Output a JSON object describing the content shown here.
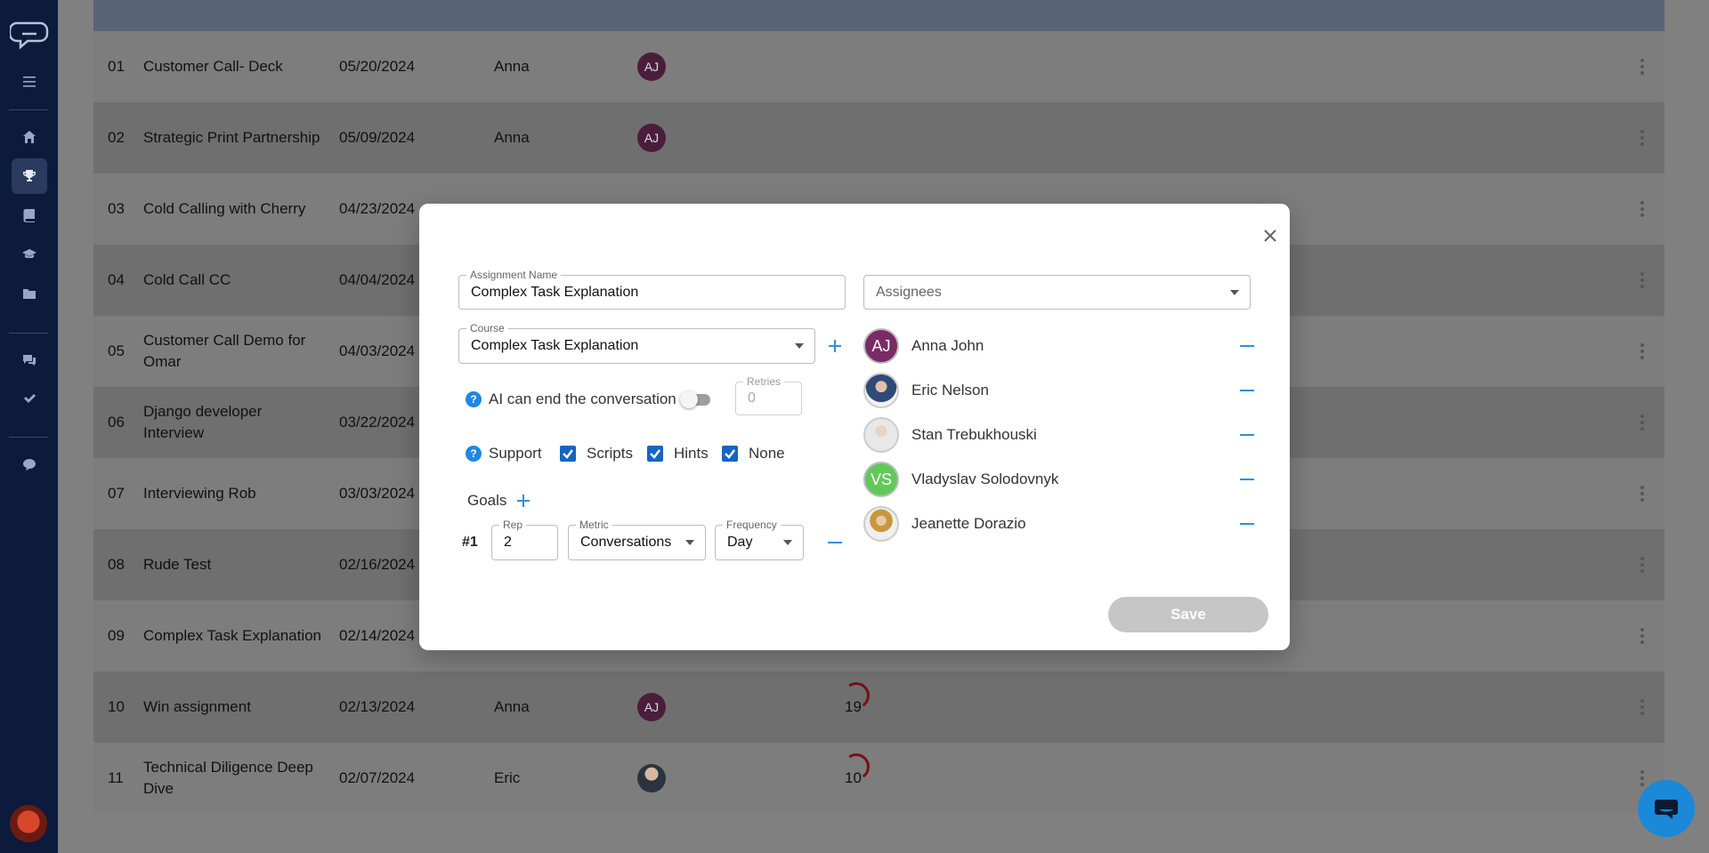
{
  "table": {
    "rows": [
      {
        "num": "01",
        "name": "Customer Call- Deck",
        "date": "05/20/2024",
        "by": "Anna",
        "avatar": "AJ",
        "progress": ""
      },
      {
        "num": "02",
        "name": "Strategic Print Partnership",
        "date": "05/09/2024",
        "by": "Anna",
        "avatar": "AJ",
        "progress": ""
      },
      {
        "num": "03",
        "name": "Cold Calling with Cherry",
        "date": "04/23/2024",
        "by": "",
        "avatar": "",
        "progress": ""
      },
      {
        "num": "04",
        "name": "Cold Call CC",
        "date": "04/04/2024",
        "by": "",
        "avatar": "",
        "progress": ""
      },
      {
        "num": "05",
        "name": "Customer Call Demo for Omar",
        "date": "04/03/2024",
        "by": "",
        "avatar": "",
        "progress": ""
      },
      {
        "num": "06",
        "name": "Django developer Interview",
        "date": "03/22/2024",
        "by": "",
        "avatar": "",
        "progress": ""
      },
      {
        "num": "07",
        "name": "Interviewing Rob",
        "date": "03/03/2024",
        "by": "",
        "avatar": "",
        "progress": ""
      },
      {
        "num": "08",
        "name": "Rude Test",
        "date": "02/16/2024",
        "by": "",
        "avatar": "",
        "progress": ""
      },
      {
        "num": "09",
        "name": "Complex Task Explanation",
        "date": "02/14/2024",
        "by": "",
        "avatar": "",
        "progress": ""
      },
      {
        "num": "10",
        "name": "Win assignment",
        "date": "02/13/2024",
        "by": "Anna",
        "avatar": "AJ",
        "progress": "19"
      },
      {
        "num": "11",
        "name": "Technical Diligence Deep Dive",
        "date": "02/07/2024",
        "by": "Eric",
        "avatar": "photo",
        "progress": "10"
      }
    ]
  },
  "modal": {
    "assignment_name": {
      "label": "Assignment Name",
      "value": "Complex Task Explanation"
    },
    "course": {
      "label": "Course",
      "value": "Complex Task Explanation"
    },
    "ai_end": {
      "label": "AI can end the conversation",
      "enabled": false
    },
    "retries": {
      "label": "Retries",
      "value": "0"
    },
    "support": {
      "label": "Support",
      "options": [
        {
          "label": "Scripts",
          "checked": true
        },
        {
          "label": "Hints",
          "checked": true
        },
        {
          "label": "None",
          "checked": true
        }
      ]
    },
    "goals": {
      "label": "Goals",
      "items": [
        {
          "index": "#1",
          "rep_label": "Rep",
          "rep": "2",
          "metric_label": "Metric",
          "metric": "Conversations",
          "frequency_label": "Frequency",
          "frequency": "Day"
        }
      ]
    },
    "assignees": {
      "placeholder": "Assignees",
      "list": [
        {
          "name": "Anna John",
          "initials": "AJ",
          "avatar_style": "purple"
        },
        {
          "name": "Eric Nelson",
          "initials": "",
          "avatar_style": "photo1"
        },
        {
          "name": "Stan Trebukhouski",
          "initials": "",
          "avatar_style": "photo2"
        },
        {
          "name": "Vladyslav Solodovnyk",
          "initials": "VS",
          "avatar_style": "green"
        },
        {
          "name": "Jeanette Dorazio",
          "initials": "",
          "avatar_style": "photo3"
        }
      ]
    },
    "save_label": "Save"
  },
  "colors": {
    "sidebar": "#0c1a3b",
    "accent": "#2f8fe0",
    "checkbox": "#1565c0",
    "save_disabled": "#c6c6c6"
  },
  "icons": [
    "logo-icon",
    "menu-icon",
    "home-icon",
    "trophy-icon",
    "book-icon",
    "graduation-cap-icon",
    "folder-icon",
    "chat-icon",
    "check-icon",
    "comment-icon",
    "close-icon",
    "plus-icon",
    "minus-icon",
    "help-icon",
    "chat-bubble-icon"
  ]
}
